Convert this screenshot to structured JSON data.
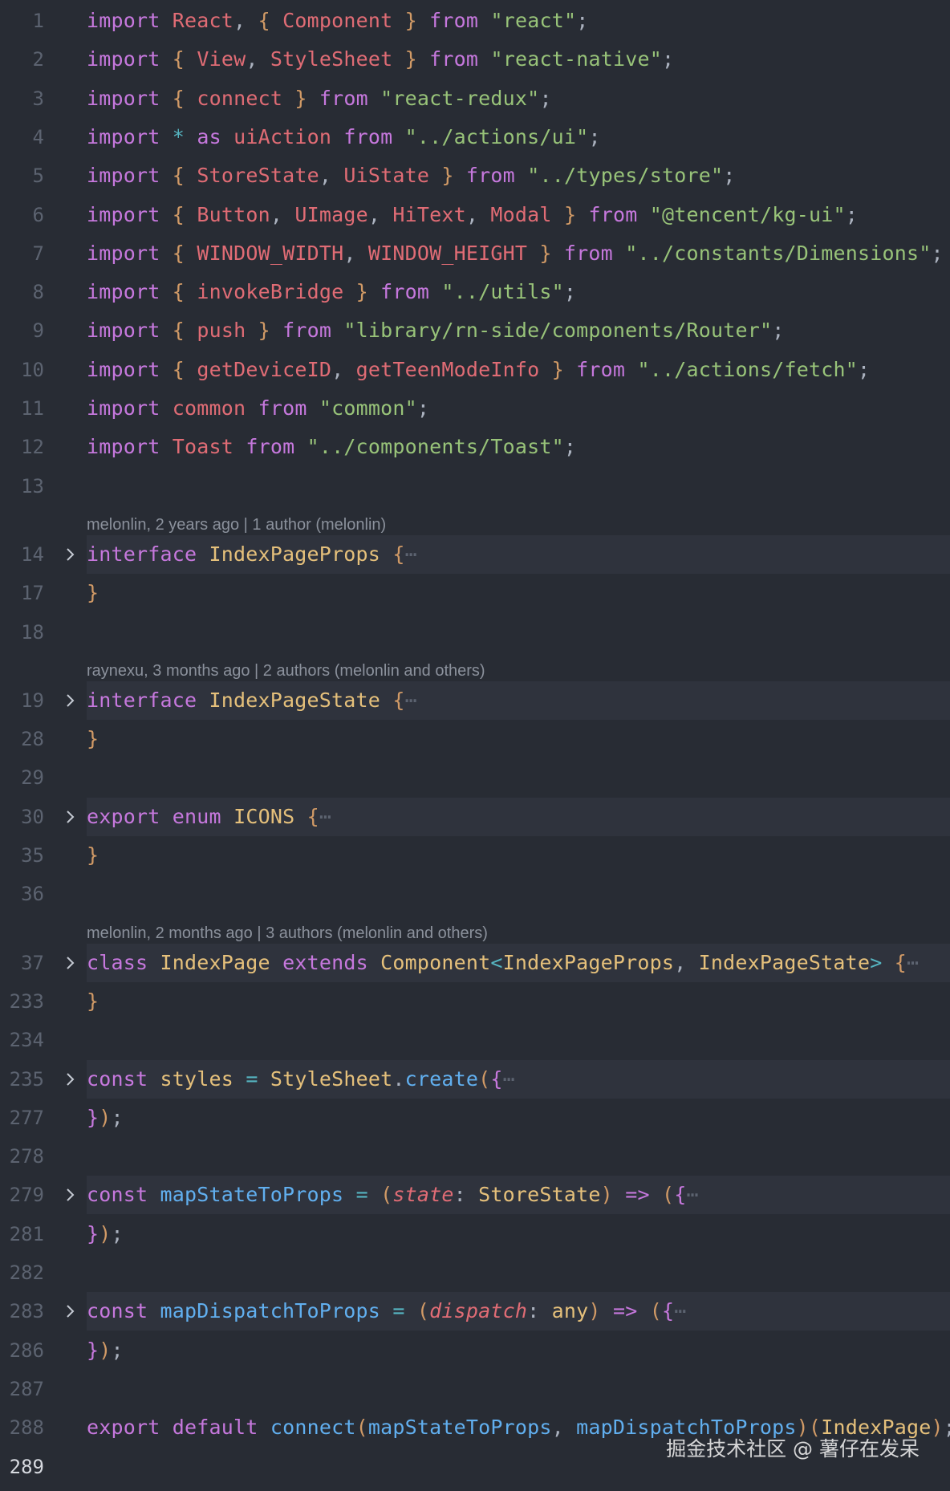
{
  "editor": {
    "current_line": "289",
    "blame": [
      {
        "before_line": "14",
        "text": "melonlin, 2 years ago | 1 author (melonlin)"
      },
      {
        "before_line": "19",
        "text": "raynexu, 3 months ago | 2 authors (melonlin and others)"
      },
      {
        "before_line": "37",
        "text": "melonlin, 2 months ago | 3 authors (melonlin and others)"
      }
    ],
    "lines": [
      {
        "num": "1",
        "tokens": [
          [
            "k",
            "import"
          ],
          [
            "p",
            " "
          ],
          [
            "v",
            "React"
          ],
          [
            "p",
            ", "
          ],
          [
            "b",
            "{"
          ],
          [
            "p",
            " "
          ],
          [
            "v",
            "Component"
          ],
          [
            "p",
            " "
          ],
          [
            "b",
            "}"
          ],
          [
            "p",
            " "
          ],
          [
            "k",
            "from"
          ],
          [
            "p",
            " "
          ],
          [
            "s",
            "\"react\""
          ],
          [
            "p",
            ";"
          ]
        ]
      },
      {
        "num": "2",
        "tokens": [
          [
            "k",
            "import"
          ],
          [
            "p",
            " "
          ],
          [
            "b",
            "{"
          ],
          [
            "p",
            " "
          ],
          [
            "v",
            "View"
          ],
          [
            "p",
            ", "
          ],
          [
            "v",
            "StyleSheet"
          ],
          [
            "p",
            " "
          ],
          [
            "b",
            "}"
          ],
          [
            "p",
            " "
          ],
          [
            "k",
            "from"
          ],
          [
            "p",
            " "
          ],
          [
            "s",
            "\"react-native\""
          ],
          [
            "p",
            ";"
          ]
        ]
      },
      {
        "num": "3",
        "tokens": [
          [
            "k",
            "import"
          ],
          [
            "p",
            " "
          ],
          [
            "b",
            "{"
          ],
          [
            "p",
            " "
          ],
          [
            "v",
            "connect"
          ],
          [
            "p",
            " "
          ],
          [
            "b",
            "}"
          ],
          [
            "p",
            " "
          ],
          [
            "k",
            "from"
          ],
          [
            "p",
            " "
          ],
          [
            "s",
            "\"react-redux\""
          ],
          [
            "p",
            ";"
          ]
        ]
      },
      {
        "num": "4",
        "tokens": [
          [
            "k",
            "import"
          ],
          [
            "p",
            " "
          ],
          [
            "o",
            "*"
          ],
          [
            "p",
            " "
          ],
          [
            "k",
            "as"
          ],
          [
            "p",
            " "
          ],
          [
            "v",
            "uiAction"
          ],
          [
            "p",
            " "
          ],
          [
            "k",
            "from"
          ],
          [
            "p",
            " "
          ],
          [
            "s",
            "\"../actions/ui\""
          ],
          [
            "p",
            ";"
          ]
        ]
      },
      {
        "num": "5",
        "tokens": [
          [
            "k",
            "import"
          ],
          [
            "p",
            " "
          ],
          [
            "b",
            "{"
          ],
          [
            "p",
            " "
          ],
          [
            "v",
            "StoreState"
          ],
          [
            "p",
            ", "
          ],
          [
            "v",
            "UiState"
          ],
          [
            "p",
            " "
          ],
          [
            "b",
            "}"
          ],
          [
            "p",
            " "
          ],
          [
            "k",
            "from"
          ],
          [
            "p",
            " "
          ],
          [
            "s",
            "\"../types/store\""
          ],
          [
            "p",
            ";"
          ]
        ]
      },
      {
        "num": "6",
        "tokens": [
          [
            "k",
            "import"
          ],
          [
            "p",
            " "
          ],
          [
            "b",
            "{"
          ],
          [
            "p",
            " "
          ],
          [
            "v",
            "Button"
          ],
          [
            "p",
            ", "
          ],
          [
            "v",
            "UImage"
          ],
          [
            "p",
            ", "
          ],
          [
            "v",
            "HiText"
          ],
          [
            "p",
            ", "
          ],
          [
            "v",
            "Modal"
          ],
          [
            "p",
            " "
          ],
          [
            "b",
            "}"
          ],
          [
            "p",
            " "
          ],
          [
            "k",
            "from"
          ],
          [
            "p",
            " "
          ],
          [
            "s",
            "\"@tencent/kg-ui\""
          ],
          [
            "p",
            ";"
          ]
        ]
      },
      {
        "num": "7",
        "tokens": [
          [
            "k",
            "import"
          ],
          [
            "p",
            " "
          ],
          [
            "b",
            "{"
          ],
          [
            "p",
            " "
          ],
          [
            "v",
            "WINDOW_WIDTH"
          ],
          [
            "p",
            ", "
          ],
          [
            "v",
            "WINDOW_HEIGHT"
          ],
          [
            "p",
            " "
          ],
          [
            "b",
            "}"
          ],
          [
            "p",
            " "
          ],
          [
            "k",
            "from"
          ],
          [
            "p",
            " "
          ],
          [
            "s",
            "\"../constants/Dimensions\""
          ],
          [
            "p",
            ";"
          ]
        ]
      },
      {
        "num": "8",
        "tokens": [
          [
            "k",
            "import"
          ],
          [
            "p",
            " "
          ],
          [
            "b",
            "{"
          ],
          [
            "p",
            " "
          ],
          [
            "v",
            "invokeBridge"
          ],
          [
            "p",
            " "
          ],
          [
            "b",
            "}"
          ],
          [
            "p",
            " "
          ],
          [
            "k",
            "from"
          ],
          [
            "p",
            " "
          ],
          [
            "s",
            "\"../utils\""
          ],
          [
            "p",
            ";"
          ]
        ]
      },
      {
        "num": "9",
        "tokens": [
          [
            "k",
            "import"
          ],
          [
            "p",
            " "
          ],
          [
            "b",
            "{"
          ],
          [
            "p",
            " "
          ],
          [
            "v",
            "push"
          ],
          [
            "p",
            " "
          ],
          [
            "b",
            "}"
          ],
          [
            "p",
            " "
          ],
          [
            "k",
            "from"
          ],
          [
            "p",
            " "
          ],
          [
            "s",
            "\"library/rn-side/components/Router\""
          ],
          [
            "p",
            ";"
          ]
        ]
      },
      {
        "num": "10",
        "tokens": [
          [
            "k",
            "import"
          ],
          [
            "p",
            " "
          ],
          [
            "b",
            "{"
          ],
          [
            "p",
            " "
          ],
          [
            "v",
            "getDeviceID"
          ],
          [
            "p",
            ", "
          ],
          [
            "v",
            "getTeenModeInfo"
          ],
          [
            "p",
            " "
          ],
          [
            "b",
            "}"
          ],
          [
            "p",
            " "
          ],
          [
            "k",
            "from"
          ],
          [
            "p",
            " "
          ],
          [
            "s",
            "\"../actions/fetch\""
          ],
          [
            "p",
            ";"
          ]
        ]
      },
      {
        "num": "11",
        "tokens": [
          [
            "k",
            "import"
          ],
          [
            "p",
            " "
          ],
          [
            "v",
            "common"
          ],
          [
            "p",
            " "
          ],
          [
            "k",
            "from"
          ],
          [
            "p",
            " "
          ],
          [
            "s",
            "\"common\""
          ],
          [
            "p",
            ";"
          ]
        ]
      },
      {
        "num": "12",
        "tokens": [
          [
            "k",
            "import"
          ],
          [
            "p",
            " "
          ],
          [
            "v",
            "Toast"
          ],
          [
            "p",
            " "
          ],
          [
            "k",
            "from"
          ],
          [
            "p",
            " "
          ],
          [
            "s",
            "\"../components/Toast\""
          ],
          [
            "p",
            ";"
          ]
        ]
      },
      {
        "num": "13",
        "tokens": []
      },
      {
        "num": "14",
        "folded": true,
        "tokens": [
          [
            "k",
            "interface"
          ],
          [
            "p",
            " "
          ],
          [
            "t",
            "IndexPageProps"
          ],
          [
            "p",
            " "
          ],
          [
            "b",
            "{"
          ],
          [
            "e",
            "⋯"
          ]
        ]
      },
      {
        "num": "17",
        "tokens": [
          [
            "b",
            "}"
          ]
        ]
      },
      {
        "num": "18",
        "tokens": []
      },
      {
        "num": "19",
        "folded": true,
        "tokens": [
          [
            "k",
            "interface"
          ],
          [
            "p",
            " "
          ],
          [
            "t",
            "IndexPageState"
          ],
          [
            "p",
            " "
          ],
          [
            "b",
            "{"
          ],
          [
            "e",
            "⋯"
          ]
        ]
      },
      {
        "num": "28",
        "tokens": [
          [
            "b",
            "}"
          ]
        ]
      },
      {
        "num": "29",
        "tokens": []
      },
      {
        "num": "30",
        "folded": true,
        "tokens": [
          [
            "k",
            "export"
          ],
          [
            "p",
            " "
          ],
          [
            "k",
            "enum"
          ],
          [
            "p",
            " "
          ],
          [
            "t",
            "ICONS"
          ],
          [
            "p",
            " "
          ],
          [
            "b",
            "{"
          ],
          [
            "e",
            "⋯"
          ]
        ]
      },
      {
        "num": "35",
        "tokens": [
          [
            "b",
            "}"
          ]
        ]
      },
      {
        "num": "36",
        "tokens": []
      },
      {
        "num": "37",
        "folded": true,
        "tokens": [
          [
            "k",
            "class"
          ],
          [
            "p",
            " "
          ],
          [
            "t",
            "IndexPage"
          ],
          [
            "p",
            " "
          ],
          [
            "k",
            "extends"
          ],
          [
            "p",
            " "
          ],
          [
            "t",
            "Component"
          ],
          [
            "o",
            "<"
          ],
          [
            "t",
            "IndexPageProps"
          ],
          [
            "p",
            ", "
          ],
          [
            "t",
            "IndexPageState"
          ],
          [
            "o",
            ">"
          ],
          [
            "p",
            " "
          ],
          [
            "b",
            "{"
          ],
          [
            "e",
            "⋯"
          ]
        ]
      },
      {
        "num": "233",
        "tokens": [
          [
            "b",
            "}"
          ]
        ]
      },
      {
        "num": "234",
        "tokens": []
      },
      {
        "num": "235",
        "folded": true,
        "tokens": [
          [
            "k",
            "const"
          ],
          [
            "p",
            " "
          ],
          [
            "t",
            "styles"
          ],
          [
            "p",
            " "
          ],
          [
            "o",
            "="
          ],
          [
            "p",
            " "
          ],
          [
            "t",
            "StyleSheet"
          ],
          [
            "p",
            "."
          ],
          [
            "f",
            "create"
          ],
          [
            "b",
            "("
          ],
          [
            "k",
            "{"
          ],
          [
            "e",
            "⋯"
          ]
        ]
      },
      {
        "num": "277",
        "tokens": [
          [
            "k",
            "}"
          ],
          [
            "b",
            ")"
          ],
          [
            "p",
            ";"
          ]
        ]
      },
      {
        "num": "278",
        "tokens": []
      },
      {
        "num": "279",
        "folded": true,
        "tokens": [
          [
            "k",
            "const"
          ],
          [
            "p",
            " "
          ],
          [
            "f",
            "mapStateToProps"
          ],
          [
            "p",
            " "
          ],
          [
            "o",
            "="
          ],
          [
            "p",
            " "
          ],
          [
            "b",
            "("
          ],
          [
            "i",
            "state"
          ],
          [
            "p",
            ": "
          ],
          [
            "t",
            "StoreState"
          ],
          [
            "b",
            ")"
          ],
          [
            "p",
            " "
          ],
          [
            "k",
            "=>"
          ],
          [
            "p",
            " "
          ],
          [
            "b",
            "("
          ],
          [
            "k",
            "{"
          ],
          [
            "e",
            "⋯"
          ]
        ]
      },
      {
        "num": "281",
        "tokens": [
          [
            "k",
            "}"
          ],
          [
            "b",
            ")"
          ],
          [
            "p",
            ";"
          ]
        ]
      },
      {
        "num": "282",
        "tokens": []
      },
      {
        "num": "283",
        "folded": true,
        "tokens": [
          [
            "k",
            "const"
          ],
          [
            "p",
            " "
          ],
          [
            "f",
            "mapDispatchToProps"
          ],
          [
            "p",
            " "
          ],
          [
            "o",
            "="
          ],
          [
            "p",
            " "
          ],
          [
            "b",
            "("
          ],
          [
            "i",
            "dispatch"
          ],
          [
            "p",
            ": "
          ],
          [
            "t",
            "any"
          ],
          [
            "b",
            ")"
          ],
          [
            "p",
            " "
          ],
          [
            "k",
            "=>"
          ],
          [
            "p",
            " "
          ],
          [
            "b",
            "("
          ],
          [
            "k",
            "{"
          ],
          [
            "e",
            "⋯"
          ]
        ]
      },
      {
        "num": "286",
        "tokens": [
          [
            "k",
            "}"
          ],
          [
            "b",
            ")"
          ],
          [
            "p",
            ";"
          ]
        ]
      },
      {
        "num": "287",
        "tokens": []
      },
      {
        "num": "288",
        "tokens": [
          [
            "k",
            "export"
          ],
          [
            "p",
            " "
          ],
          [
            "k",
            "default"
          ],
          [
            "p",
            " "
          ],
          [
            "f",
            "connect"
          ],
          [
            "b",
            "("
          ],
          [
            "f",
            "mapStateToProps"
          ],
          [
            "p",
            ", "
          ],
          [
            "f",
            "mapDispatchToProps"
          ],
          [
            "b",
            ")("
          ],
          [
            "t",
            "IndexPage"
          ],
          [
            "b",
            ")"
          ],
          [
            "p",
            ";"
          ]
        ]
      },
      {
        "num": "289",
        "tokens": []
      }
    ]
  },
  "watermark": "掘金技术社区 @ 薯仔在发呆"
}
